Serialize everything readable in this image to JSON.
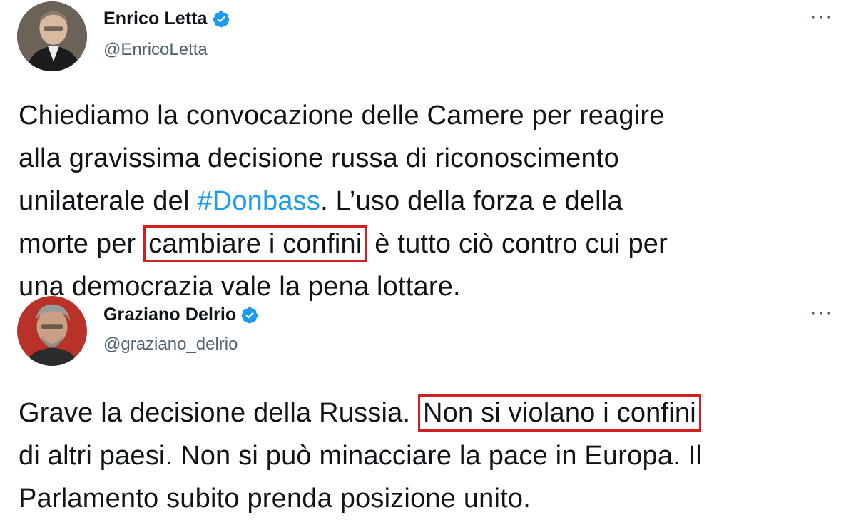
{
  "tweets": [
    {
      "author_name": "Enrico Letta",
      "handle": "@EnricoLetta",
      "more_label": "···",
      "lines": [
        {
          "text": "Chiediamo la convocazione delle Camere per reagire"
        },
        {
          "text": "alla gravissima decisione russa di riconoscimento"
        },
        {
          "before": "unilaterale del ",
          "hashtag": "#Donbass",
          "after": ". L’uso della forza e della"
        },
        {
          "before": "morte per ",
          "highlight": "cambiare i confini",
          "after": " è tutto ciò contro cui per"
        },
        {
          "text": "una democrazia vale la pena lottare."
        }
      ]
    },
    {
      "author_name": "Graziano Delrio",
      "handle": "@graziano_delrio",
      "more_label": "···",
      "lines": [
        {
          "before": "Grave la decisione della Russia. ",
          "highlight": "Non si violano i confini"
        },
        {
          "text": "di altri paesi. Non si può minacciare la pace in Europa. Il"
        },
        {
          "text": "Parlamento subito prenda posizione unito."
        }
      ]
    }
  ],
  "colors": {
    "hashtag": "#1d9bf0",
    "highlight_border": "#d21f1f",
    "verified_badge": "#1d9bf0",
    "secondary_text": "#536471"
  }
}
